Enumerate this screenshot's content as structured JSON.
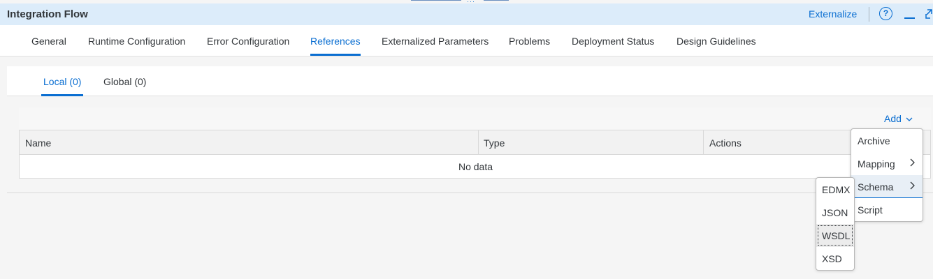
{
  "app": {
    "title": "Integration Flow"
  },
  "header": {
    "externalize_label": "Externalize",
    "help_glyph": "?",
    "icons": [
      "help-icon",
      "minimize-icon",
      "expand-icon"
    ]
  },
  "tabs": [
    {
      "label": "General"
    },
    {
      "label": "Runtime Configuration"
    },
    {
      "label": "Error Configuration"
    },
    {
      "label": "References",
      "active": true
    },
    {
      "label": "Externalized Parameters"
    },
    {
      "label": "Problems"
    },
    {
      "label": "Deployment Status"
    },
    {
      "label": "Design Guidelines"
    }
  ],
  "subtabs": [
    {
      "label": "Local (0)",
      "active": true
    },
    {
      "label": "Global (0)"
    }
  ],
  "toolbar": {
    "add_label": "Add",
    "add_icon": "chevron-down-icon"
  },
  "table": {
    "columns": [
      "Name",
      "Type",
      "Actions"
    ],
    "empty_text": "No data"
  },
  "add_menu": {
    "items": [
      {
        "label": "Archive",
        "has_submenu": false
      },
      {
        "label": "Mapping",
        "has_submenu": true
      },
      {
        "label": "Schema",
        "has_submenu": true,
        "hovered": true
      },
      {
        "label": "Script",
        "has_submenu": false
      }
    ],
    "submenu_arrow": "chevron-right-icon"
  },
  "schema_menu": {
    "items": [
      {
        "label": "EDMX"
      },
      {
        "label": "JSON"
      },
      {
        "label": "WSDL",
        "focused": true
      },
      {
        "label": "XSD"
      }
    ]
  },
  "colors": {
    "accent": "#0a6ed1",
    "header_bg": "#dcecfa",
    "text": "#32363a",
    "page_bg": "#f5f5f5"
  }
}
